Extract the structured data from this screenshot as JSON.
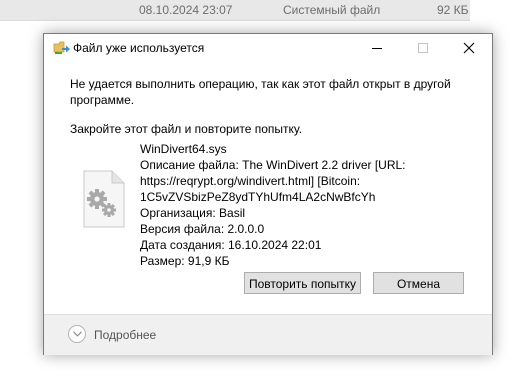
{
  "background_row": {
    "date": "08.10.2024 23:07",
    "type": "Системный файл",
    "size": "92 КБ"
  },
  "dialog": {
    "title": "Файл уже используется",
    "message": "Не удается выполнить операцию, так как этот файл открыт в другой программе.",
    "instruction": "Закройте этот файл и повторите попытку.",
    "file": {
      "name": "WinDivert64.sys",
      "description_lines": [
        "Описание файла: The WinDivert 2.2 driver [URL:",
        "https://reqrypt.org/windivert.html] [Bitcoin:",
        "1C5vZVSbizPeZ8ydTYhUfm4LA2cNwBfcYh"
      ],
      "organization": "Организация: Basil",
      "version": "Версия файла: 2.0.0.0",
      "created": "Дата создания: 16.10.2024 22:01",
      "size": "Размер: 91,9 КБ"
    },
    "buttons": {
      "retry": "Повторить попытку",
      "cancel": "Отмена"
    },
    "details_toggle": "Подробнее"
  },
  "icons": {
    "app": "file-move-icon",
    "file": "system-file-gear-icon"
  }
}
